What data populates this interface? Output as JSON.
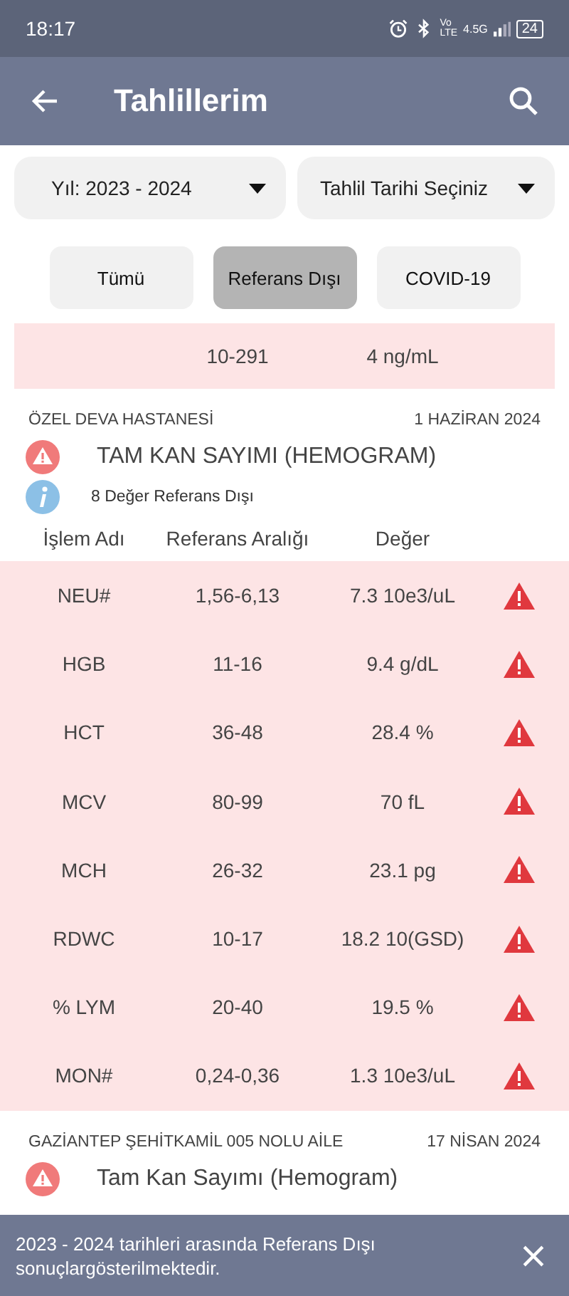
{
  "status_bar": {
    "time": "18:17",
    "volte_top": "Vo",
    "volte_bottom": "LTE",
    "network": "4.5G",
    "battery": "24"
  },
  "app_bar": {
    "title": "Tahlillerim"
  },
  "filters": [
    {
      "label": "Yıl: 2023 - 2024"
    },
    {
      "label": "Tahlil Tarihi Seçiniz"
    }
  ],
  "tabs": [
    {
      "label": "Tümü",
      "selected": false
    },
    {
      "label": "Referans Dışı",
      "selected": true
    },
    {
      "label": "COVID-19",
      "selected": false
    }
  ],
  "partial_row": {
    "range": "10-291",
    "value": "4 ng/mL"
  },
  "groups": [
    {
      "institution": "ÖZEL DEVA HASTANESİ",
      "date": "1 HAZİRAN 2024",
      "title": "TAM KAN SAYIMI (HEMOGRAM)",
      "info": "8 Değer Referans Dışı",
      "columns": [
        "İşlem Adı",
        "Referans Aralığı",
        "Değer"
      ],
      "rows": [
        {
          "name": "NEU#",
          "range": "1,56-6,13",
          "value": "7.3 10e3/uL",
          "out_of_range": true
        },
        {
          "name": "HGB",
          "range": "11-16",
          "value": "9.4 g/dL",
          "out_of_range": true
        },
        {
          "name": "HCT",
          "range": "36-48",
          "value": "28.4 %",
          "out_of_range": true
        },
        {
          "name": "MCV",
          "range": "80-99",
          "value": "70 fL",
          "out_of_range": true
        },
        {
          "name": "MCH",
          "range": "26-32",
          "value": "23.1 pg",
          "out_of_range": true
        },
        {
          "name": "RDWC",
          "range": "10-17",
          "value": "18.2 10(GSD)",
          "out_of_range": true
        },
        {
          "name": "% LYM",
          "range": "20-40",
          "value": "19.5 %",
          "out_of_range": true
        },
        {
          "name": "MON#",
          "range": "0,24-0,36",
          "value": "1.3 10e3/uL",
          "out_of_range": true
        }
      ]
    },
    {
      "institution": "GAZİANTEP ŞEHİTKAMİL 005 NOLU AİLE",
      "date": "17 NİSAN 2024",
      "title": "Tam Kan Sayımı (Hemogram)"
    }
  ],
  "snackbar": {
    "message": "2023 - 2024 tarihleri arasında Referans Dışı sonuçlargösterilmektedir."
  }
}
